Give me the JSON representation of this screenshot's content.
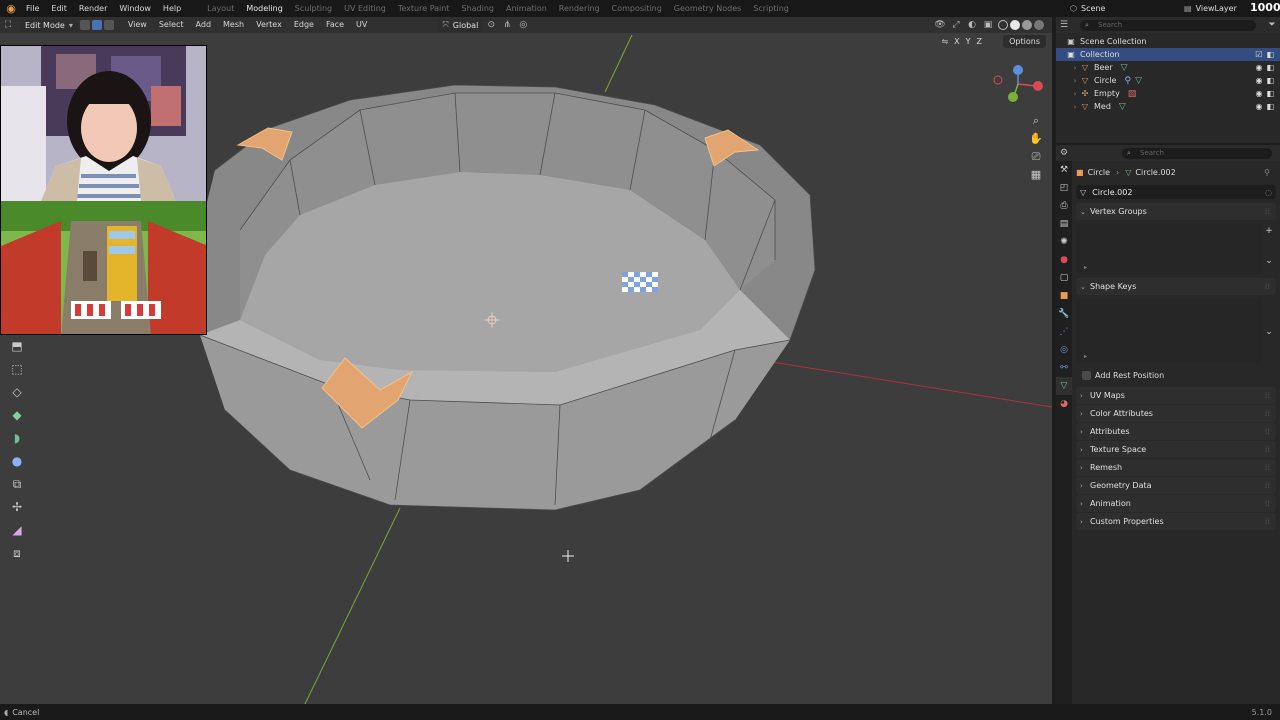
{
  "topbar": {
    "menu": [
      "File",
      "Edit",
      "Render",
      "Window",
      "Help"
    ],
    "workspaces": [
      "Layout",
      "Modeling",
      "Sculpting",
      "UV Editing",
      "Texture Paint",
      "Shading",
      "Animation",
      "Rendering",
      "Compositing",
      "Geometry Nodes",
      "Scripting"
    ],
    "active_workspace": "Modeling",
    "scene": "Scene",
    "view_layer": "ViewLayer",
    "brand": "1000"
  },
  "viewport_header": {
    "mode": "Edit Mode",
    "menus": [
      "View",
      "Select",
      "Add",
      "Mesh",
      "Vertex",
      "Edge",
      "Face",
      "UV"
    ],
    "orientation": "Global",
    "axis_toggles": [
      "X",
      "Y",
      "Z"
    ],
    "options_label": "Options"
  },
  "outliner": {
    "search_placeholder": "Search",
    "scene_collection": "Scene Collection",
    "collection": "Collection",
    "items": [
      {
        "name": "Beer"
      },
      {
        "name": "Circle"
      },
      {
        "name": "Empty"
      },
      {
        "name": "Med"
      }
    ]
  },
  "properties": {
    "search_placeholder": "Search",
    "breadcrumb_object": "Circle",
    "breadcrumb_data": "Circle.002",
    "datablock_name": "Circle.002",
    "sections": {
      "vertex_groups": "Vertex Groups",
      "shape_keys": "Shape Keys",
      "add_rest_position": "Add Rest Position"
    },
    "collapsed_sections": [
      "UV Maps",
      "Color Attributes",
      "Attributes",
      "Texture Space",
      "Remesh",
      "Geometry Data",
      "Animation",
      "Custom Properties"
    ]
  },
  "statusbar": {
    "left": "Cancel",
    "version": "5.1.0"
  },
  "colors": {
    "selected_face": "#e2a572",
    "mesh_gray": "#9a9a9a",
    "x_axis": "#c2343f",
    "y_axis": "#6b9b2a",
    "accent_blue": "#4772b3"
  }
}
